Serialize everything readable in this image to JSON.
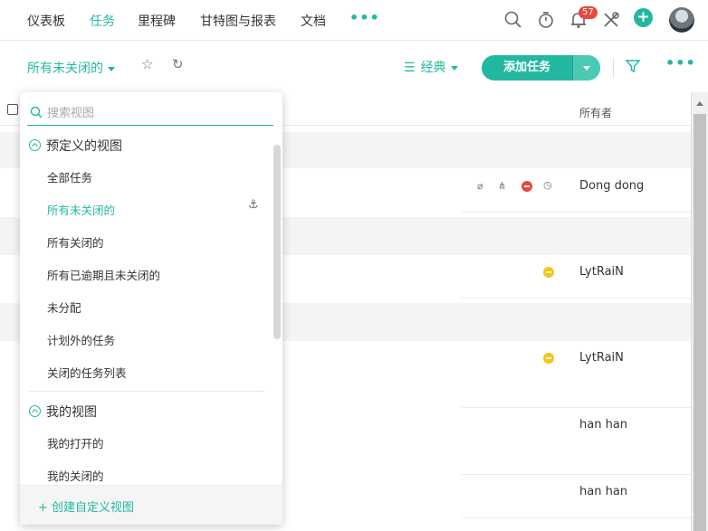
{
  "nav": {
    "items": [
      "仪表板",
      "任务",
      "里程碑",
      "甘特图与报表",
      "文档"
    ],
    "active": "任务",
    "more": "•••",
    "notification_count": "57"
  },
  "toolbar": {
    "view_label": "所有未关闭的",
    "layout_label": "经典",
    "add_task_label": "添加任务",
    "more": "•••"
  },
  "table": {
    "owner_header": "所有者",
    "rows": [
      {
        "owner": "Dong dong"
      },
      {
        "owner": "LytRaiN"
      },
      {
        "owner": "LytRaiN"
      },
      {
        "owner": "han han"
      },
      {
        "owner": "han han"
      }
    ]
  },
  "dropdown": {
    "search_placeholder": "搜索视图",
    "predefined_title": "预定义的视图",
    "predefined": [
      "全部任务",
      "所有未关闭的",
      "所有关闭的",
      "所有已逾期且未关闭的",
      "未分配",
      "计划外的任务",
      "关闭的任务列表"
    ],
    "selected": "所有未关闭的",
    "my_title": "我的视图",
    "my_views": [
      "我的打开的",
      "我的关闭的"
    ],
    "create_label": "+ 创建自定义视图"
  },
  "colors": {
    "accent": "#22b8a0",
    "badge": "#e8493d",
    "warning": "#f6c515"
  }
}
